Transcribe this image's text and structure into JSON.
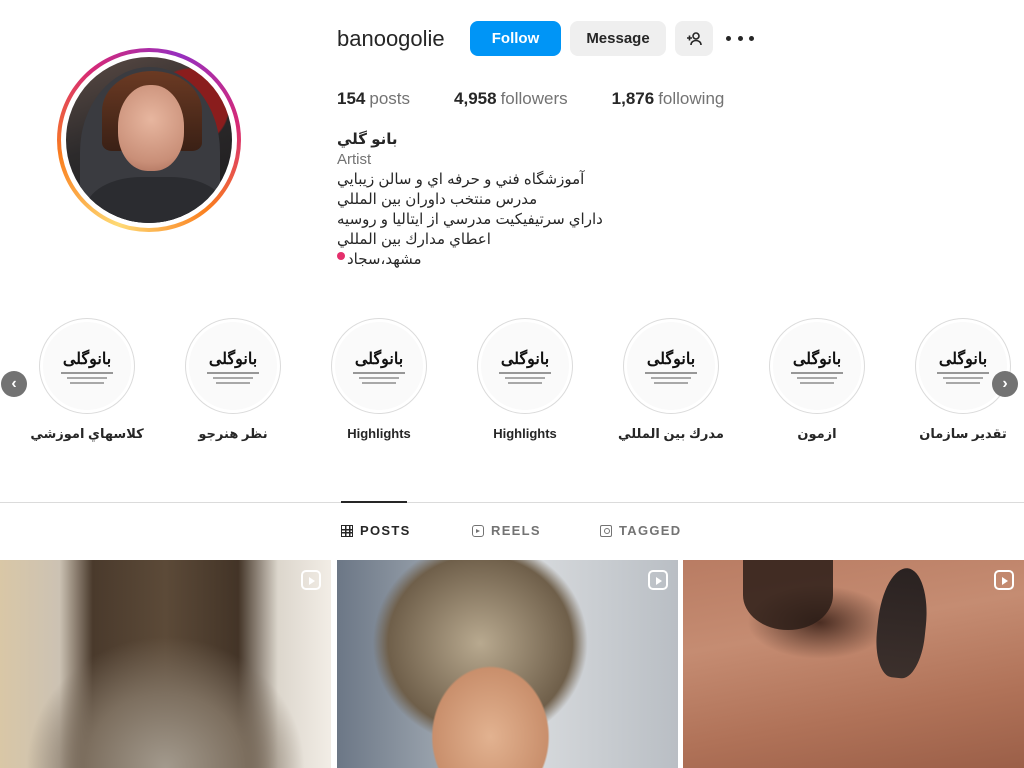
{
  "profile": {
    "username": "banoogolie",
    "follow_label": "Follow",
    "message_label": "Message",
    "add_user_glyph": "+♙",
    "more_icon": "more-horizontal-icon"
  },
  "stats": {
    "posts_count": "154",
    "posts_label": "posts",
    "followers_count": "4,958",
    "followers_label": "followers",
    "following_count": "1,876",
    "following_label": "following"
  },
  "bio": {
    "name": "بانو گلي",
    "category": "Artist",
    "line1": "آموزشگاه فني و حرفه اي و سالن زيبايي",
    "line2": "مدرس منتخب داوران بين المللي",
    "line3": "داراي سرتيفيكيت مدرسي از ايتاليا و روسيه",
    "line4": "اعطاي مدارك بين المللي",
    "line5": "مشهد،سجاد",
    "location_icon": "pin-icon"
  },
  "highlights": [
    {
      "label": "كلاسهاي اموزشي",
      "cover_text": "بانوگلی"
    },
    {
      "label": "نظر هنرجو",
      "cover_text": "بانوگلی"
    },
    {
      "label": "Highlights",
      "cover_text": "بانوگلی"
    },
    {
      "label": "Highlights",
      "cover_text": "بانوگلی"
    },
    {
      "label": "مدرك بين المللي",
      "cover_text": "بانوگلی"
    },
    {
      "label": "ازمون",
      "cover_text": "بانوگلی"
    },
    {
      "label": "تقدير سازمان",
      "cover_text": "بانوگلی"
    }
  ],
  "tabs": {
    "posts": "POSTS",
    "reels": "REELS",
    "tagged": "TAGGED"
  },
  "colors": {
    "follow_button": "#0095f6",
    "secondary_button": "#efefef",
    "text_primary": "#262626",
    "text_secondary": "#737373"
  }
}
